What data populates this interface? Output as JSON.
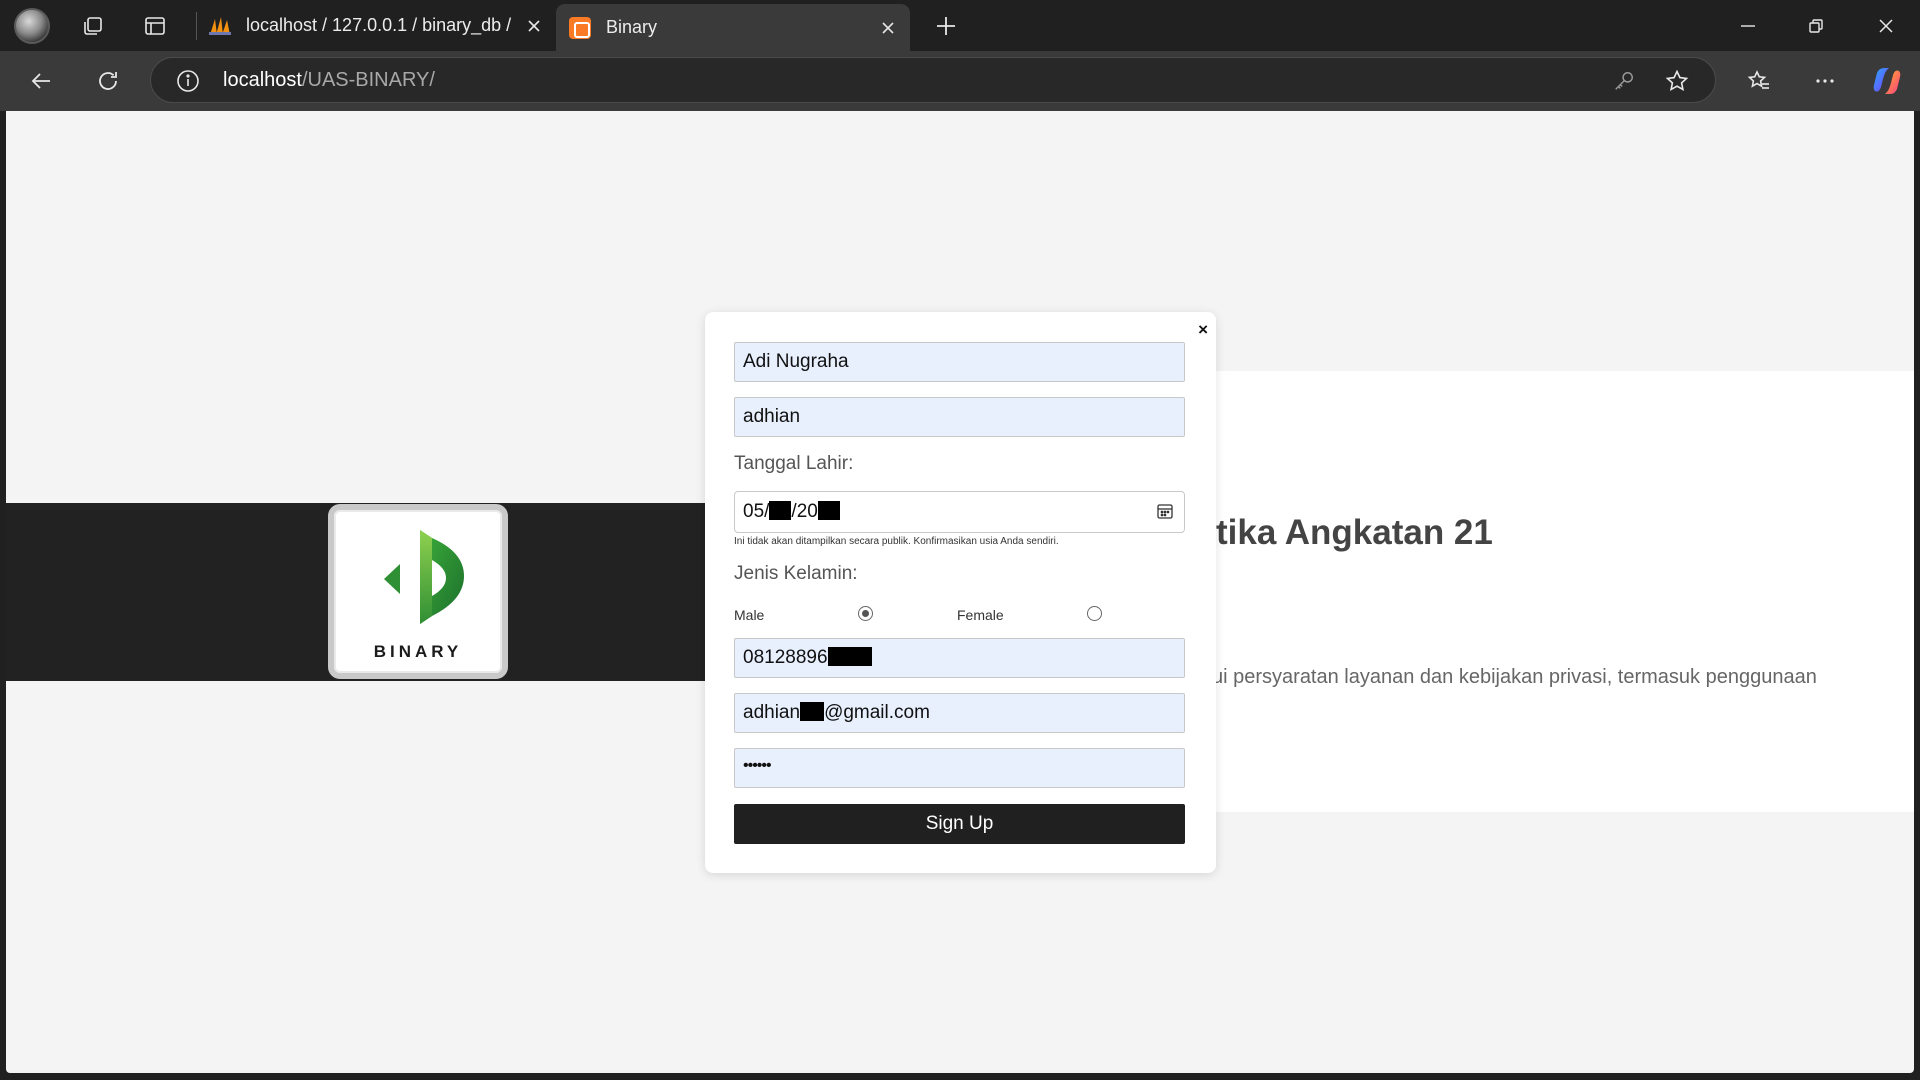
{
  "browser": {
    "tabs": [
      {
        "title": "localhost / 127.0.0.1 / binary_db /",
        "favicon": "phpmyadmin-icon"
      },
      {
        "title": "Binary",
        "favicon": "xampp-icon",
        "active": true
      }
    ],
    "url_host": "localhost",
    "url_path": "/UAS-BINARY/"
  },
  "page": {
    "logo_text": "BINARY",
    "heading_partial": "tika Angkatan 21",
    "paragraph_partial": "ui persyaratan layanan dan kebijakan privasi, termasuk penggunaan"
  },
  "modal": {
    "close_label": "×",
    "full_name_value": "Adi Nugraha",
    "username_value": "adhian",
    "birth_label": "Tanggal Lahir:",
    "birth_parts": [
      "05/",
      "/20"
    ],
    "birth_hint": "Ini tidak akan ditampilkan secara publik. Konfirmasikan usia Anda sendiri.",
    "gender_label": "Jenis Kelamin:",
    "gender_male": "Male",
    "gender_female": "Female",
    "gender_selected": "Male",
    "phone_value": "08128896",
    "email_prefix": "adhian",
    "email_suffix": "@gmail.com",
    "password_value": "••••••",
    "submit_label": "Sign Up"
  },
  "colors": {
    "accent_dark": "#202020",
    "autofill_bg": "#e8f0fe",
    "logo_green_dark": "#1e7a2e",
    "logo_green_light": "#6cc04a",
    "xampp_orange": "#fb7a24"
  }
}
